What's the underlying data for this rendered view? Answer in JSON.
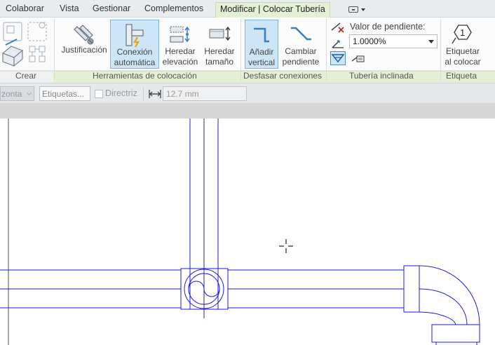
{
  "tabs": [
    {
      "label": "Colaborar",
      "active": false
    },
    {
      "label": "Vista",
      "active": false
    },
    {
      "label": "Gestionar",
      "active": false
    },
    {
      "label": "Complementos",
      "active": false
    },
    {
      "label": "Modificar | Colocar Tubería",
      "active": true
    }
  ],
  "ribbon": {
    "crear": {
      "title": "Crear"
    },
    "herramientas": {
      "title": "Herramientas de colocación",
      "justificacion": "Justificación",
      "conexion_1": "Conexión",
      "conexion_2": "automática",
      "heredar_elev_1": "Heredar",
      "heredar_elev_2": "elevación",
      "heredar_tam_1": "Heredar",
      "heredar_tam_2": "tamaño"
    },
    "desfasar": {
      "title": "Desfasar conexiones",
      "anadir_1": "Añadir",
      "anadir_2": "vertical",
      "cambiar_1": "Cambiar",
      "cambiar_2": "pendiente"
    },
    "tuberia_inclinada": {
      "title": "Tubería inclinada",
      "slope_label": "Valor de pendiente:",
      "slope_value": "1.0000%"
    },
    "etiqueta": {
      "title": "Etiqueta",
      "etiquetar_1": "Etiquetar",
      "etiquetar_2": "al colocar",
      "tag_number": "1"
    }
  },
  "options_bar": {
    "orientation_value": "zonta",
    "tag_placeholder": "Etiquetas...",
    "directriz_label": "Directriz",
    "directriz_checked": false,
    "dimension_value": "12.7 mm"
  },
  "colors": {
    "active_tab": "#e3f0d4",
    "selected_button": "#cde6f7",
    "pipe_line": "#1a1ae0"
  }
}
